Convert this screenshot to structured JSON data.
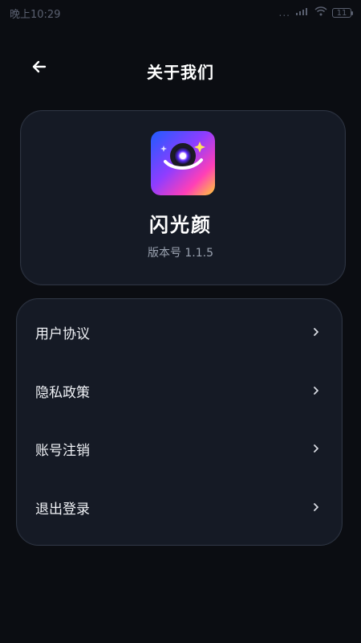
{
  "status_bar": {
    "time": "晚上10:29",
    "dots": "...",
    "battery": "11",
    "signal_icon": "signal-icon",
    "wifi_icon": "wifi-icon"
  },
  "header": {
    "title": "关于我们",
    "back_icon": "arrow-left-icon"
  },
  "app": {
    "name": "闪光颜",
    "version": "版本号 1.1.5",
    "icon": "app-logo-icon"
  },
  "menu": {
    "items": [
      {
        "label": "用户协议"
      },
      {
        "label": "隐私政策"
      },
      {
        "label": "账号注销"
      },
      {
        "label": "退出登录"
      }
    ]
  },
  "colors": {
    "background": "#0b0d12",
    "card": "#151a25",
    "border": "#2d3442",
    "text": "#ffffff",
    "muted": "#9aa2b0",
    "status": "#5a6070"
  }
}
